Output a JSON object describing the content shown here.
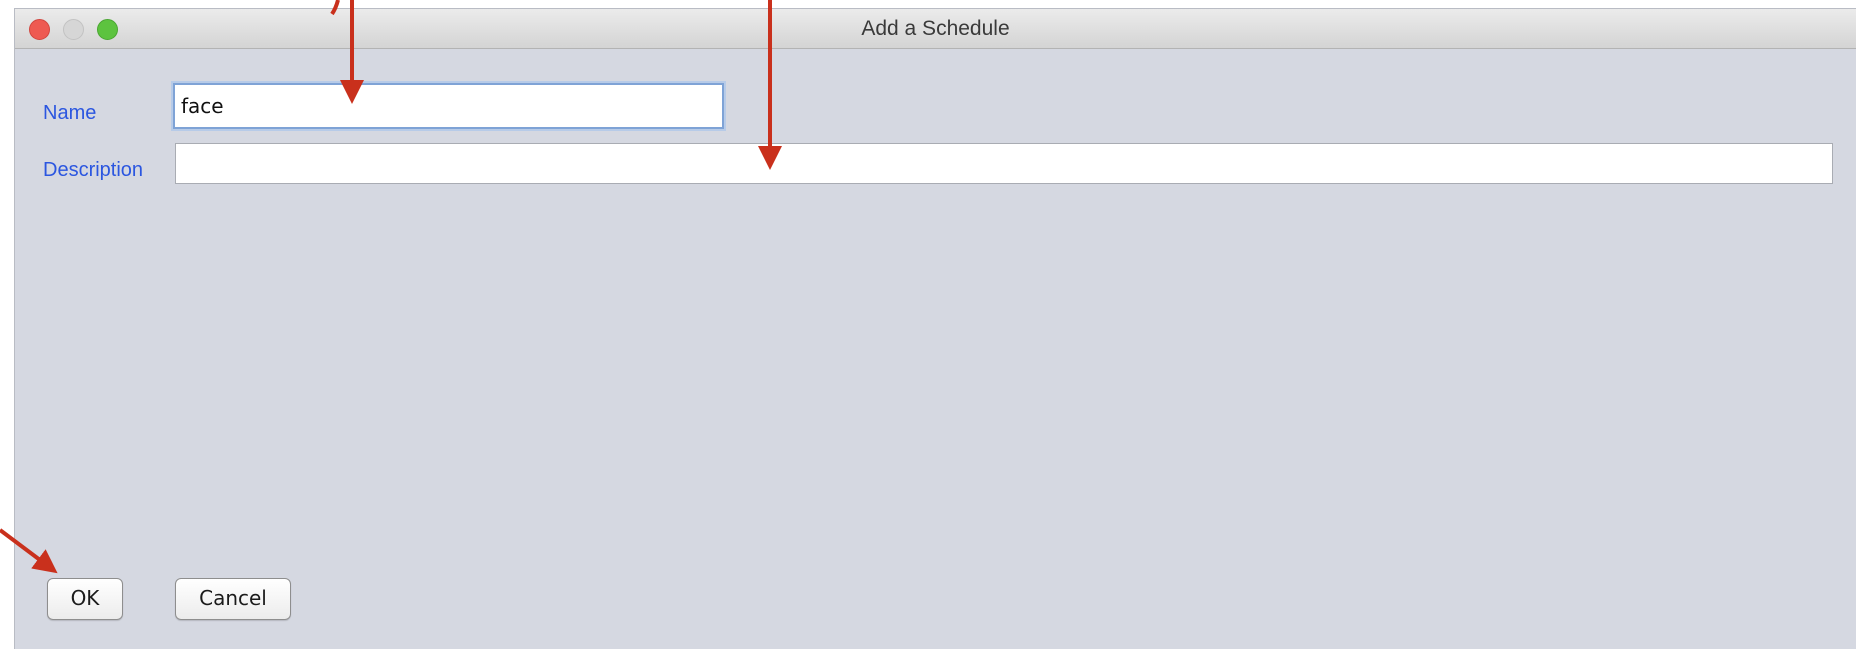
{
  "window": {
    "title": "Add a Schedule"
  },
  "form": {
    "name_label": "Name",
    "name_value": "face",
    "description_label": "Description",
    "description_value": ""
  },
  "buttons": {
    "ok_label": "OK",
    "cancel_label": "Cancel"
  },
  "colors": {
    "label_blue": "#2b56e0",
    "annotation_red": "#c9301c",
    "window_bg": "#d5d8e1"
  }
}
